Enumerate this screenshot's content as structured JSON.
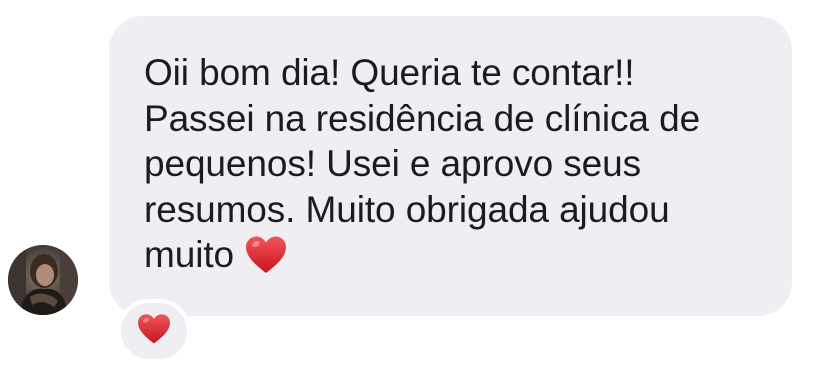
{
  "message": {
    "text": "Oii bom dia! Queria te contar!!\nPassei na residência de clínica de\npequenos! Usei e aprovo seus\nresumos. Muito obrigada ajudou\nmuito",
    "inline_emoji": "red-heart-icon",
    "bubble_color": "#efeff3",
    "text_color": "#1c1c1e"
  },
  "reaction": {
    "emoji": "red-heart-icon",
    "color": "#e0282e"
  },
  "sender": {
    "avatar": "avatar"
  }
}
